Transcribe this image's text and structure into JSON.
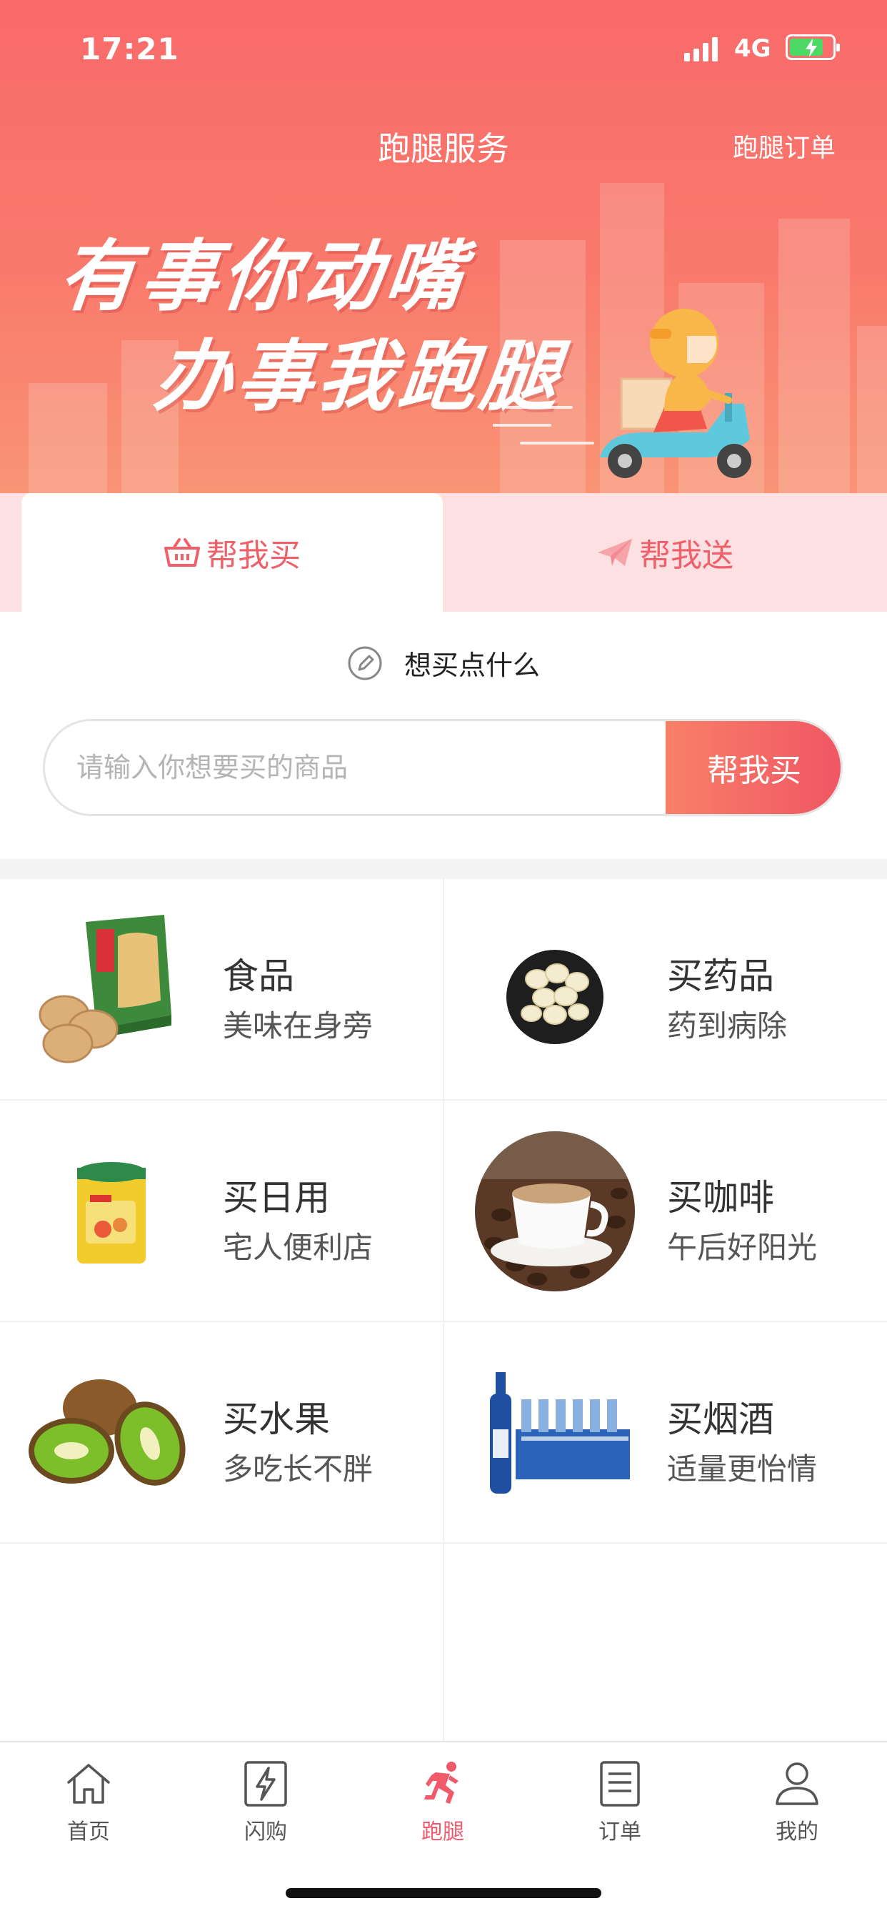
{
  "status_bar": {
    "time": "17:21",
    "network": "4G"
  },
  "header": {
    "title": "跑腿服务",
    "action": "跑腿订单",
    "slogan_line1": "有事你动嘴",
    "slogan_line2": "办事我跑腿"
  },
  "tabs": [
    {
      "label": "帮我买",
      "icon": "basket-icon",
      "active": true
    },
    {
      "label": "帮我送",
      "icon": "paper-plane-icon",
      "active": false
    }
  ],
  "prompt": {
    "text": "想买点什么",
    "icon": "pencil-icon"
  },
  "search": {
    "placeholder": "请输入你想要买的商品",
    "value": "",
    "button_label": "帮我买"
  },
  "categories": [
    {
      "title": "食品",
      "subtitle": "美味在身旁",
      "image": "crackers-box-image"
    },
    {
      "title": "买药品",
      "subtitle": "药到病除",
      "image": "medicine-bowl-image"
    },
    {
      "title": "买日用",
      "subtitle": "宅人便利店",
      "image": "canister-image"
    },
    {
      "title": "买咖啡",
      "subtitle": "午后好阳光",
      "image": "coffee-cup-image"
    },
    {
      "title": "买水果",
      "subtitle": "多吃长不胖",
      "image": "kiwi-image"
    },
    {
      "title": "买烟酒",
      "subtitle": "适量更怡情",
      "image": "beer-case-image"
    }
  ],
  "tabbar": [
    {
      "label": "首页",
      "icon": "home-icon",
      "active": false
    },
    {
      "label": "闪购",
      "icon": "lightning-icon",
      "active": false
    },
    {
      "label": "跑腿",
      "icon": "runner-icon",
      "active": true
    },
    {
      "label": "订单",
      "icon": "order-list-icon",
      "active": false
    },
    {
      "label": "我的",
      "icon": "user-icon",
      "active": false
    }
  ],
  "colors": {
    "brand": "#f05a6a",
    "hero_top": "#f96a6a",
    "hero_bottom": "#f9a27a",
    "tab_inactive_bg": "#fde0e1",
    "battery": "#4cd964"
  },
  "battery_level": 0.8
}
